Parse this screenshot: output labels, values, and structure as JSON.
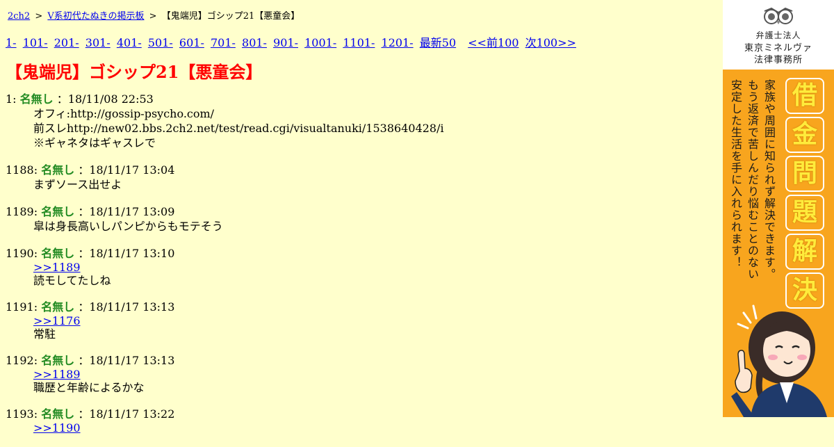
{
  "breadcrumb": {
    "home": "2ch2",
    "board": "V系初代たぬきの掲示板",
    "current": "【鬼端児】ゴシップ21【悪童会】",
    "separator": ">"
  },
  "pager": {
    "ranges": [
      "1-",
      "101-",
      "201-",
      "301-",
      "401-",
      "501-",
      "601-",
      "701-",
      "801-",
      "901-",
      "1001-",
      "1101-",
      "1201-"
    ],
    "latest": "最新50",
    "prev": "<<前100",
    "next": "次100>>"
  },
  "thread_title": "【鬼端児】ゴシップ21【悪童会】",
  "posts": [
    {
      "num": "1:",
      "name": "名無し",
      "date": "：18/11/08 22:53",
      "lines": [
        "オフィ:http://gossip-psycho.com/",
        "前スレhttp://new02.bbs.2ch2.net/test/read.cgi/visualtanuki/1538640428/i",
        "※ギャネタはギャスレで"
      ]
    },
    {
      "num": "1188:",
      "name": "名無し",
      "date": "：18/11/17 13:04",
      "lines": [
        "まずソース出せよ"
      ]
    },
    {
      "num": "1189:",
      "name": "名無し",
      "date": "：18/11/17 13:09",
      "lines": [
        "皐は身長高いしパンピからもモテそう"
      ]
    },
    {
      "num": "1190:",
      "name": "名無し",
      "date": "：18/11/17 13:10",
      "anchor": ">>1189",
      "lines": [
        "読モしてたしね"
      ]
    },
    {
      "num": "1191:",
      "name": "名無し",
      "date": "：18/11/17 13:13",
      "anchor": ">>1176",
      "lines": [
        "常駐"
      ]
    },
    {
      "num": "1192:",
      "name": "名無し",
      "date": "：18/11/17 13:13",
      "anchor": ">>1189",
      "lines": [
        "職歴と年齢によるかな"
      ]
    },
    {
      "num": "1193:",
      "name": "名無し",
      "date": "：18/11/17 13:22",
      "anchor": ">>1190",
      "lines": []
    }
  ],
  "ad": {
    "firm_line1": "弁護士法人",
    "firm_line2": "東京ミネルヴァ",
    "firm_line3": "法律事務所",
    "headline_chars": [
      "借",
      "金",
      "問",
      "題",
      "解",
      "決"
    ],
    "copy_col1": "家族や周囲に知られず解決できます。",
    "copy_col2": "もう返済で苦しんだり悩むことのない",
    "copy_col3": "安定した生活を手に入れられます！",
    "bg_color": "#f8a51e"
  },
  "colors": {
    "page_bg": "#ffffcc",
    "title": "#ff0000",
    "name": "#228b22",
    "link": "#0000ee"
  }
}
